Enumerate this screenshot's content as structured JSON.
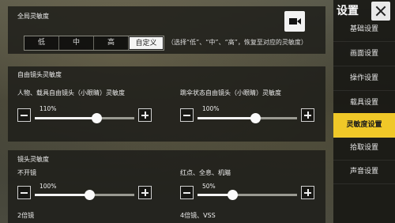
{
  "global": {
    "title": "全局灵敏度",
    "options": [
      "低",
      "中",
      "高",
      "自定义"
    ],
    "active_index": 3,
    "hint": "（选择“低”、“中”、“高”，恢复至对应的灵敏度）"
  },
  "free_look": {
    "title": "自由镜头灵敏度",
    "sliders": [
      {
        "label": "人物、载具自由镜头（小眼睛）灵敏度",
        "value_text": "110%",
        "fill": 0.62
      },
      {
        "label": "跳伞状态自由镜头（小眼睛）灵敏度",
        "value_text": "100%",
        "fill": 0.58
      }
    ]
  },
  "scope": {
    "title": "镜头灵敏度",
    "sliders": [
      {
        "label": "不开镜",
        "value_text": "100%",
        "fill": 0.55
      },
      {
        "label": "红点、全息、机瞄",
        "value_text": "50%",
        "fill": 0.35
      }
    ],
    "more": [
      "2倍镜",
      "4倍镜、VSS"
    ]
  },
  "sidebar": {
    "title": "设置",
    "items": [
      "基础设置",
      "画面设置",
      "操作设置",
      "载具设置",
      "灵敏度设置",
      "拾取设置",
      "声音设置"
    ],
    "active_index": 4
  }
}
